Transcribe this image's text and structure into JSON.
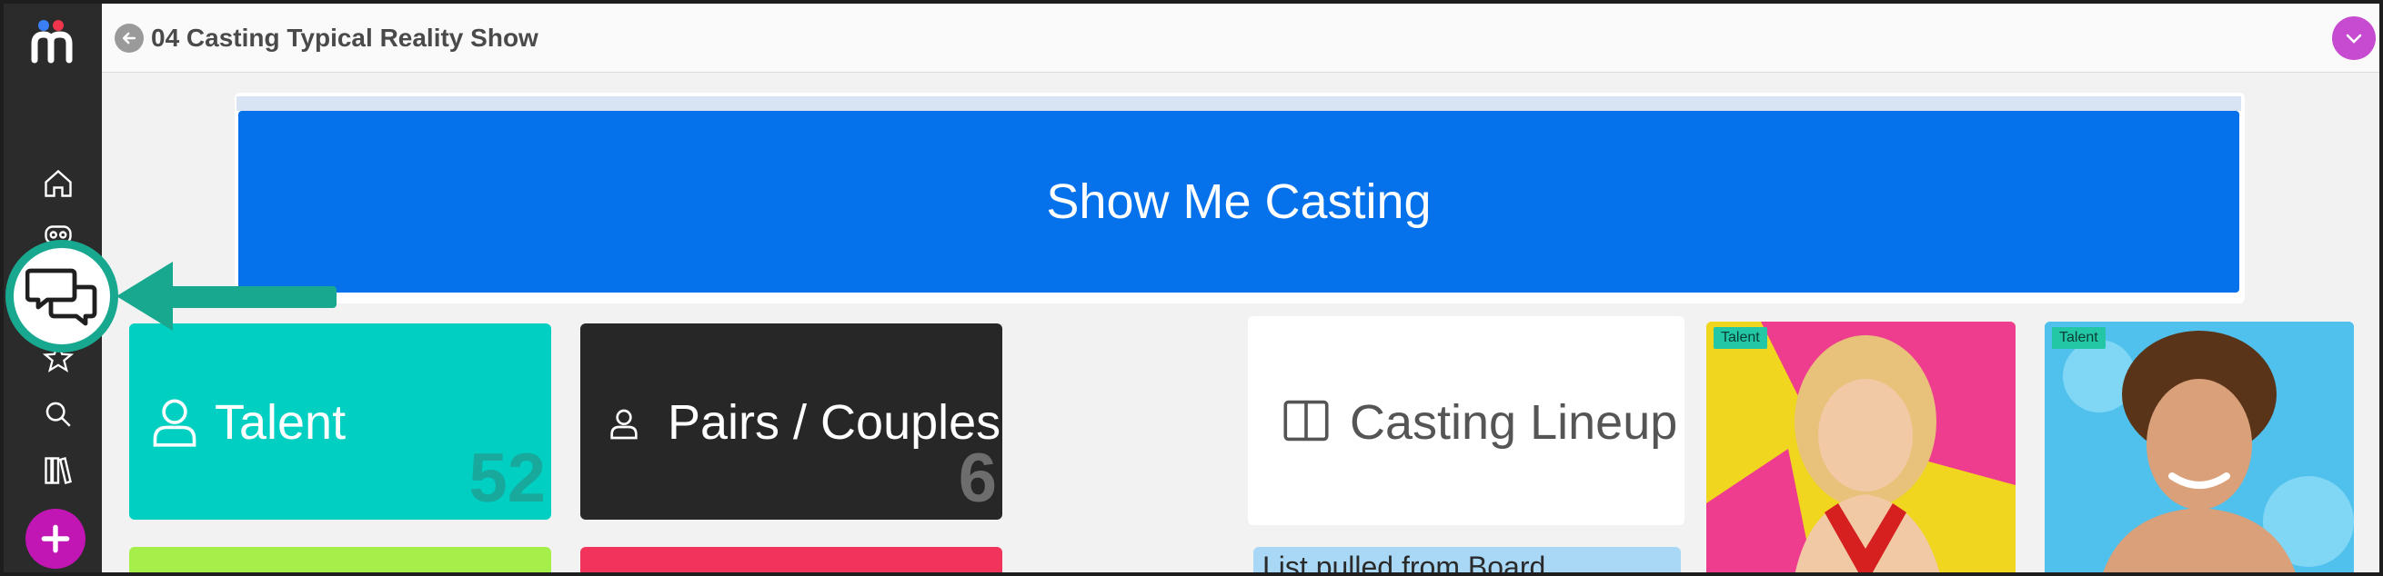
{
  "header": {
    "title": "04 Casting Typical Reality Show"
  },
  "sidebar": {
    "items": [
      {
        "icon": "home-icon"
      },
      {
        "icon": "bot-icon"
      },
      {
        "icon": "chat-icon"
      },
      {
        "icon": "star-icon"
      },
      {
        "icon": "search-icon"
      },
      {
        "icon": "library-icon"
      },
      {
        "icon": "plus-icon"
      }
    ]
  },
  "banner": {
    "text": "Show Me Casting"
  },
  "tiles": {
    "talent": {
      "label": "Talent",
      "count": "52",
      "color": "#00cfc1"
    },
    "pairs": {
      "label": "Pairs / Couples",
      "count": "6",
      "color": "#272727"
    },
    "lineup": {
      "label": "Casting Lineup"
    },
    "green_tile_color": "#a6ef4a",
    "red_tile_color": "#f2345c"
  },
  "list_note": {
    "text": "List pulled from Board"
  },
  "photos": [
    {
      "tag": "Talent",
      "bg": "#f0d61f"
    },
    {
      "tag": "Talent",
      "bg": "#4fc1ec"
    }
  ],
  "colors": {
    "sidebar_bg": "#2b2b2b",
    "accent_purple": "#c116b4",
    "banner_blue": "#0571ea",
    "callout_teal": "#18a88f"
  }
}
